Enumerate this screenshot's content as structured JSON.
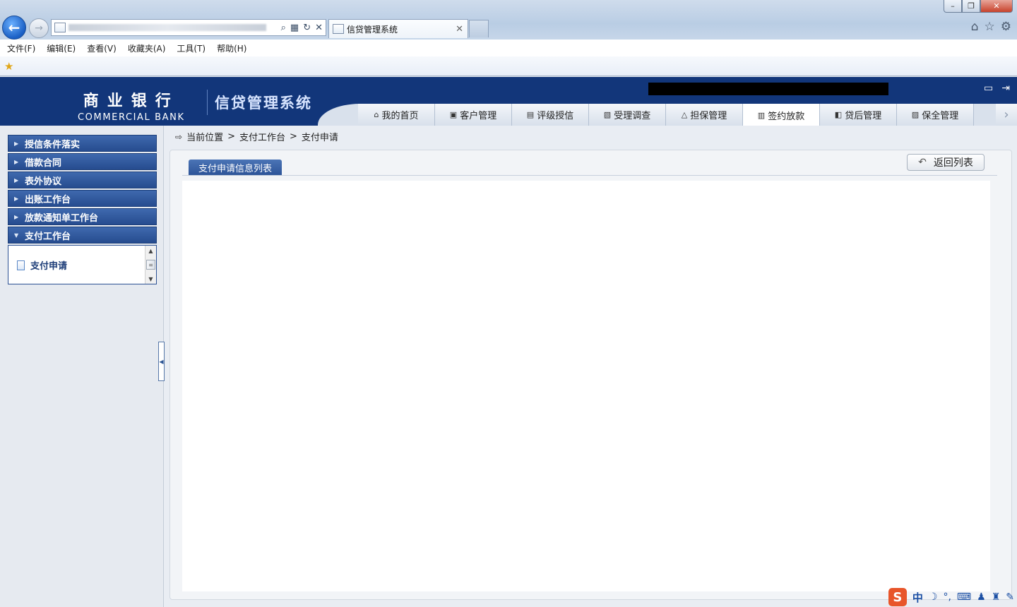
{
  "browser": {
    "tab_title": "信贷管理系统",
    "tab_close": "✕",
    "menu": [
      "文件(F)",
      "编辑(E)",
      "查看(V)",
      "收藏夹(A)",
      "工具(T)",
      "帮助(H)"
    ]
  },
  "header": {
    "logo_cn": "商业银行",
    "logo_en": "COMMERCIAL BANK",
    "system_title": "信贷管理系统",
    "nav_tabs": [
      {
        "label": "我的首页",
        "icon": "home-icon",
        "active": false
      },
      {
        "label": "客户管理",
        "icon": "customer-icon",
        "active": false
      },
      {
        "label": "评级授信",
        "icon": "rating-icon",
        "active": false
      },
      {
        "label": "受理调查",
        "icon": "survey-icon",
        "active": false
      },
      {
        "label": "担保管理",
        "icon": "guarantee-icon",
        "active": false
      },
      {
        "label": "签约放款",
        "icon": "contract-icon",
        "active": true
      },
      {
        "label": "贷后管理",
        "icon": "post-loan-icon",
        "active": false
      },
      {
        "label": "保全管理",
        "icon": "preservation-icon",
        "active": false
      }
    ]
  },
  "sidebar": {
    "items": [
      {
        "label": "授信条件落实",
        "expanded": false
      },
      {
        "label": "借款合同",
        "expanded": false
      },
      {
        "label": "表外协议",
        "expanded": false
      },
      {
        "label": "出账工作台",
        "expanded": false
      },
      {
        "label": "放款通知单工作台",
        "expanded": false
      },
      {
        "label": "支付工作台",
        "expanded": true
      }
    ],
    "sub_items": [
      {
        "label": "支付申请"
      }
    ]
  },
  "breadcrumb": {
    "prefix": "当前位置",
    "sep": ">",
    "level1": "支付工作台",
    "level2": "支付申请"
  },
  "main": {
    "panel_tab": "支付申请信息列表",
    "back_button": "返回列表"
  },
  "ime": {
    "logo": "S",
    "mode": "中"
  },
  "colors": {
    "header_bg": "#12367a",
    "sidebar_item_bg": "#264c8f",
    "panel_tab_bg": "#2c5397"
  }
}
